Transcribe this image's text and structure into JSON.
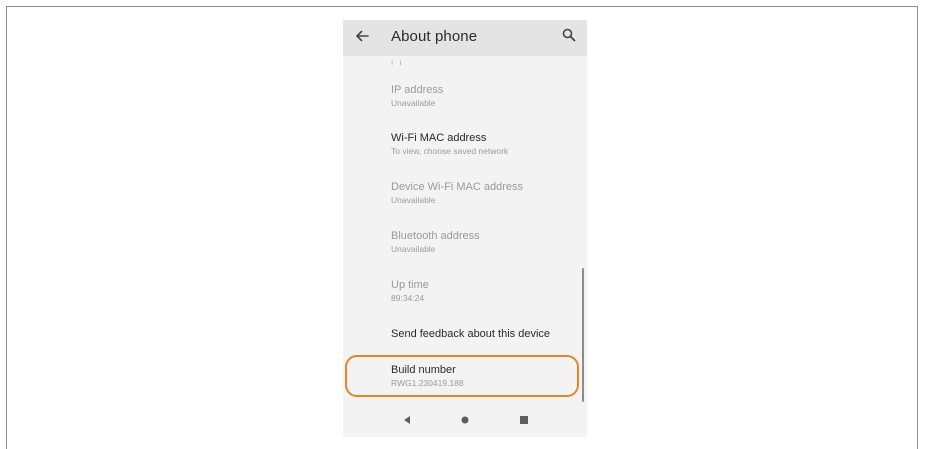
{
  "appbar": {
    "title": "About phone"
  },
  "items": [
    {
      "title": "IP address",
      "subtitle": "Unavailable"
    },
    {
      "title": "Wi-Fi MAC address",
      "subtitle": "To view, choose saved network"
    },
    {
      "title": "Device Wi-Fi MAC address",
      "subtitle": "Unavailable"
    },
    {
      "title": "Bluetooth address",
      "subtitle": "Unavailable"
    },
    {
      "title": "Up time",
      "subtitle": "89:34:24"
    },
    {
      "title": "Send feedback about this device"
    },
    {
      "title": "Build number",
      "subtitle": "RWG1.230419.188"
    }
  ],
  "colors": {
    "highlight": "#e98427",
    "background": "#f3f3f3",
    "appbar": "#e4e4e4"
  },
  "icons": {
    "back": "arrow-left",
    "search": "magnifier",
    "nav_back": "triangle-left",
    "nav_home": "circle",
    "nav_recents": "square"
  }
}
